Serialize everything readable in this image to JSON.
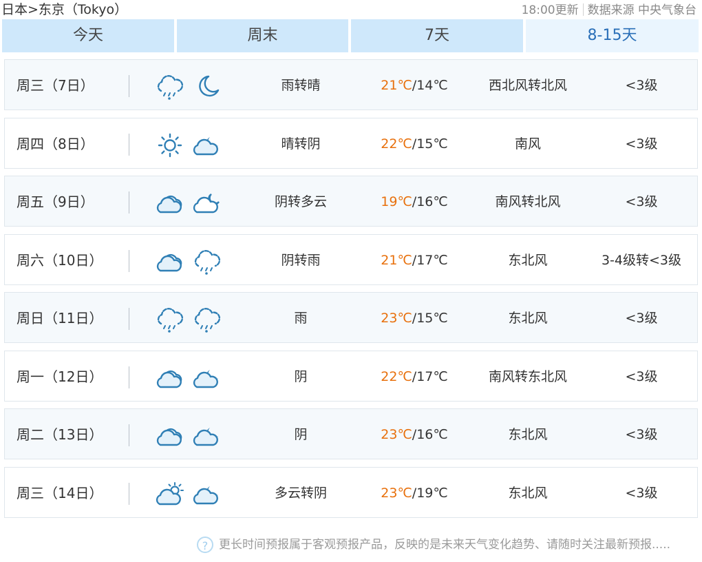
{
  "header": {
    "breadcrumb": "日本>东京（Tokyo）",
    "update_time": "18:00更新",
    "source": "数据来源 中央气象台"
  },
  "tabs": [
    {
      "label": "今天",
      "active": false
    },
    {
      "label": "周末",
      "active": false
    },
    {
      "label": "7天",
      "active": false
    },
    {
      "label": "8-15天",
      "active": true
    }
  ],
  "colors": {
    "tab_bg": "#cfe8fb",
    "tab_active_text": "#2a6fb8",
    "high_temp": "#e8700c",
    "icon": "#2f7fb5"
  },
  "forecast": [
    {
      "day": "周三（7日）",
      "icon1": "rain-cloud-icon",
      "icon2": "moon-icon",
      "desc": "雨转晴",
      "high": "21℃",
      "low": "14℃",
      "wind": "西北风转北风",
      "level": "<3级"
    },
    {
      "day": "周四（8日）",
      "icon1": "sun-icon",
      "icon2": "cloudy-night-icon",
      "desc": "晴转阴",
      "high": "22℃",
      "low": "15℃",
      "wind": "南风",
      "level": "<3级"
    },
    {
      "day": "周五（9日）",
      "icon1": "overcast-icon",
      "icon2": "partly-cloudy-night-icon",
      "desc": "阴转多云",
      "high": "19℃",
      "low": "16℃",
      "wind": "南风转北风",
      "level": "<3级"
    },
    {
      "day": "周六（10日）",
      "icon1": "overcast-icon",
      "icon2": "rain-cloud-icon",
      "desc": "阴转雨",
      "high": "21℃",
      "low": "17℃",
      "wind": "东北风",
      "level": "3-4级转<3级"
    },
    {
      "day": "周日（11日）",
      "icon1": "rain-cloud-icon",
      "icon2": "rain-cloud-icon",
      "desc": "雨",
      "high": "23℃",
      "low": "15℃",
      "wind": "东北风",
      "level": "<3级"
    },
    {
      "day": "周一（12日）",
      "icon1": "overcast-icon",
      "icon2": "cloudy-night-icon",
      "desc": "阴",
      "high": "22℃",
      "low": "17℃",
      "wind": "南风转东北风",
      "level": "<3级"
    },
    {
      "day": "周二（13日）",
      "icon1": "overcast-icon",
      "icon2": "cloudy-night-icon",
      "desc": "阴",
      "high": "23℃",
      "low": "16℃",
      "wind": "东北风",
      "level": "<3级"
    },
    {
      "day": "周三（14日）",
      "icon1": "partly-cloudy-day-icon",
      "icon2": "cloudy-night-icon",
      "desc": "多云转阴",
      "high": "23℃",
      "low": "19℃",
      "wind": "东北风",
      "level": "<3级"
    }
  ],
  "footer": {
    "note": "更长时间预报属于客观预报产品，反映的是未来天气变化趋势、请随时关注最新预报....."
  }
}
